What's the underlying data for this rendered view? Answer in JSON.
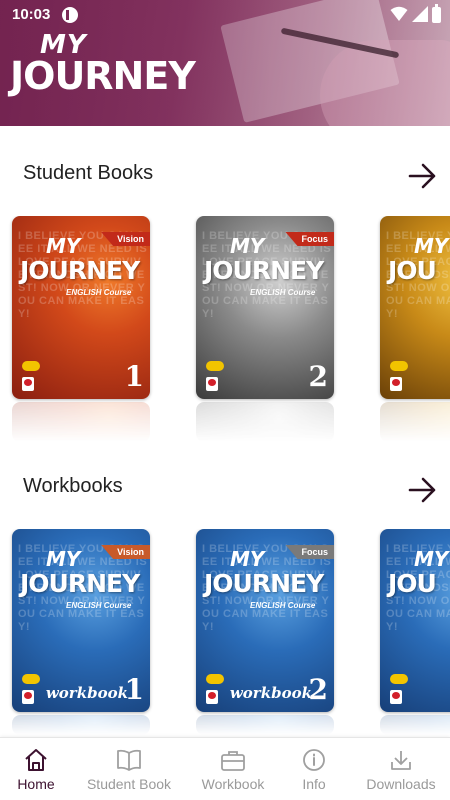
{
  "status_bar": {
    "time": "10:03"
  },
  "header": {
    "logo_line1": "MY",
    "logo_line2": "JOURNEY"
  },
  "sections": {
    "student_books": {
      "title": "Student Books",
      "books": [
        {
          "brand_top": "MY",
          "brand": "JOURNEY",
          "course": "ENGLISH Course",
          "ribbon": "Vision",
          "volume": "1"
        },
        {
          "brand_top": "MY",
          "brand": "JOURNEY",
          "course": "ENGLISH Course",
          "ribbon": "Focus",
          "volume": "2"
        },
        {
          "brand_top": "MY",
          "brand": "JOU"
        }
      ]
    },
    "workbooks": {
      "title": "Workbooks",
      "books": [
        {
          "brand_top": "MY",
          "brand": "JOURNEY",
          "course": "ENGLISH Course",
          "ribbon": "Vision",
          "wb_label": "workbook",
          "volume": "1"
        },
        {
          "brand_top": "MY",
          "brand": "JOURNEY",
          "course": "ENGLISH Course",
          "ribbon": "Focus",
          "wb_label": "workbook",
          "volume": "2"
        },
        {
          "brand_top": "MY",
          "brand": "JOU"
        }
      ]
    }
  },
  "cover_background_words": "I BELIEVE YOU CAN SEE IT ALL WE NEED IS LOVE PEACE SURVIVE FRIENDSHIP GO WEST! NOW OR NEVER YOU CAN MAKE IT EASY!",
  "bottom_nav": {
    "items": [
      {
        "label": "Home",
        "icon": "home-icon",
        "active": true
      },
      {
        "label": "Student Book",
        "icon": "book-icon",
        "active": false
      },
      {
        "label": "Workbook",
        "icon": "briefcase-icon",
        "active": false
      },
      {
        "label": "Info",
        "icon": "info-icon",
        "active": false
      },
      {
        "label": "Downloads",
        "icon": "download-icon",
        "active": false
      }
    ]
  },
  "colors": {
    "brand": "#7a2a56",
    "nav_active": "#3d1230",
    "nav_inactive": "#9a9a9a"
  }
}
